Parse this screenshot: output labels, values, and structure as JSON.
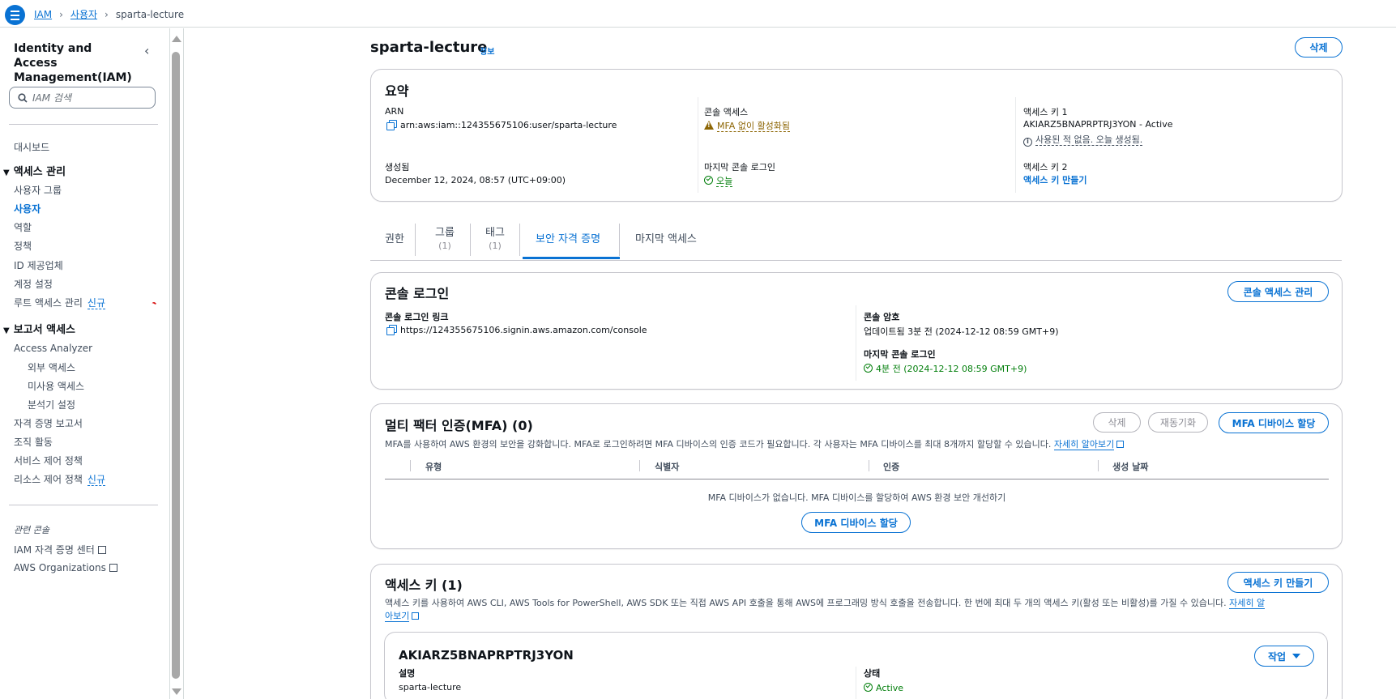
{
  "breadcrumb": {
    "root": "IAM",
    "users": "사용자",
    "current": "sparta-lecture"
  },
  "sidebar": {
    "title": "Identity and Access Management(IAM)",
    "search_placeholder": "IAM 검색",
    "dashboard": "대시보드",
    "section_access": "액세스 관리",
    "access_items": [
      "사용자 그룹",
      "사용자",
      "역할",
      "정책",
      "ID 제공업체",
      "계정 설정",
      "루트 액세스 관리"
    ],
    "new_badge": "신규",
    "section_reports": "보고서 액세스",
    "access_analyzer": "Access Analyzer",
    "analyzer_items": [
      "외부 액세스",
      "미사용 액세스",
      "분석기 설정"
    ],
    "report_items": [
      "자격 증명 보고서",
      "조직 활동",
      "서비스 제어 정책",
      "리소스 제어 정책"
    ],
    "related_title": "관련 콘솔",
    "related_items": [
      "IAM 자격 증명 센터",
      "AWS Organizations"
    ]
  },
  "page": {
    "title": "sparta-lecture",
    "info": "정보",
    "delete": "삭제"
  },
  "summary": {
    "title": "요약",
    "arn_label": "ARN",
    "arn_value": "arn:aws:iam::124355675106:user/sparta-lecture",
    "created_label": "생성됨",
    "created_value": "December 12, 2024, 08:57 (UTC+09:00)",
    "console_access_label": "콘솔 액세스",
    "console_access_value": "MFA 없이 활성화됨",
    "last_login_label": "마지막 콘솔 로그인",
    "last_login_value": "오늘",
    "key1_label": "액세스 키 1",
    "key1_value": "AKIARZ5BNAPRPTRJ3YON - Active",
    "key1_note": "사용된 적 없음. 오늘 생성됨.",
    "key2_label": "액세스 키 2",
    "key2_value": "액세스 키 만들기"
  },
  "tabs": [
    {
      "label": "권한",
      "count": ""
    },
    {
      "label": "그룹",
      "count": "(1)"
    },
    {
      "label": "태그",
      "count": "(1)"
    },
    {
      "label": "보안 자격 증명",
      "count": ""
    },
    {
      "label": "마지막 액세스",
      "count": ""
    }
  ],
  "console_login": {
    "title": "콘솔 로그인",
    "manage_button": "콘솔 액세스 관리",
    "link_label": "콘솔 로그인 링크",
    "link_value": "https://124355675106.signin.aws.amazon.com/console",
    "password_label": "콘솔 암호",
    "password_value": "업데이트됨 3분 전 (2024-12-12 08:59 GMT+9)",
    "last_login_label": "마지막 콘솔 로그인",
    "last_login_value": "4분 전 (2024-12-12 08:59 GMT+9)"
  },
  "mfa": {
    "title": "멀티 팩터 인증(MFA) (0)",
    "delete_button": "삭제",
    "resync_button": "재동기화",
    "assign_button": "MFA 디바이스 할당",
    "description": "MFA를 사용하여 AWS 환경의 보안을 강화합니다. MFA로 로그인하려면 MFA 디바이스의 인증 코드가 필요합니다. 각 사용자는 MFA 디바이스를 최대 8개까지 할당할 수 있습니다.",
    "learn_more": "자세히 알아보기",
    "columns": [
      "유형",
      "식별자",
      "인증",
      "생성 날짜"
    ],
    "empty_text": "MFA 디바이스가 없습니다. MFA 디바이스를 할당하여 AWS 환경 보안 개선하기",
    "empty_button": "MFA 디바이스 할당"
  },
  "access_keys": {
    "title": "액세스 키 (1)",
    "create_button": "액세스 키 만들기",
    "description": "액세스 키를 사용하여 AWS CLI, AWS Tools for PowerShell, AWS SDK 또는 직접 AWS API 호출을 통해 AWS에 프로그래밍 방식 호출을 전송합니다. 한 번에 최대 두 개의 액세스 키(활성 또는 비활성)를 가질 수 있습니다.",
    "learn_more_1": "자세히 알",
    "learn_more_2": "아보기",
    "key_id": "AKIARZ5BNAPRPTRJ3YON",
    "actions_button": "작업",
    "desc_label": "설명",
    "desc_value": "sparta-lecture",
    "status_label": "상태",
    "status_value": "Active"
  },
  "colors": {
    "accent": "#0972d3",
    "success": "#037f0c",
    "warning": "#8d6605"
  }
}
